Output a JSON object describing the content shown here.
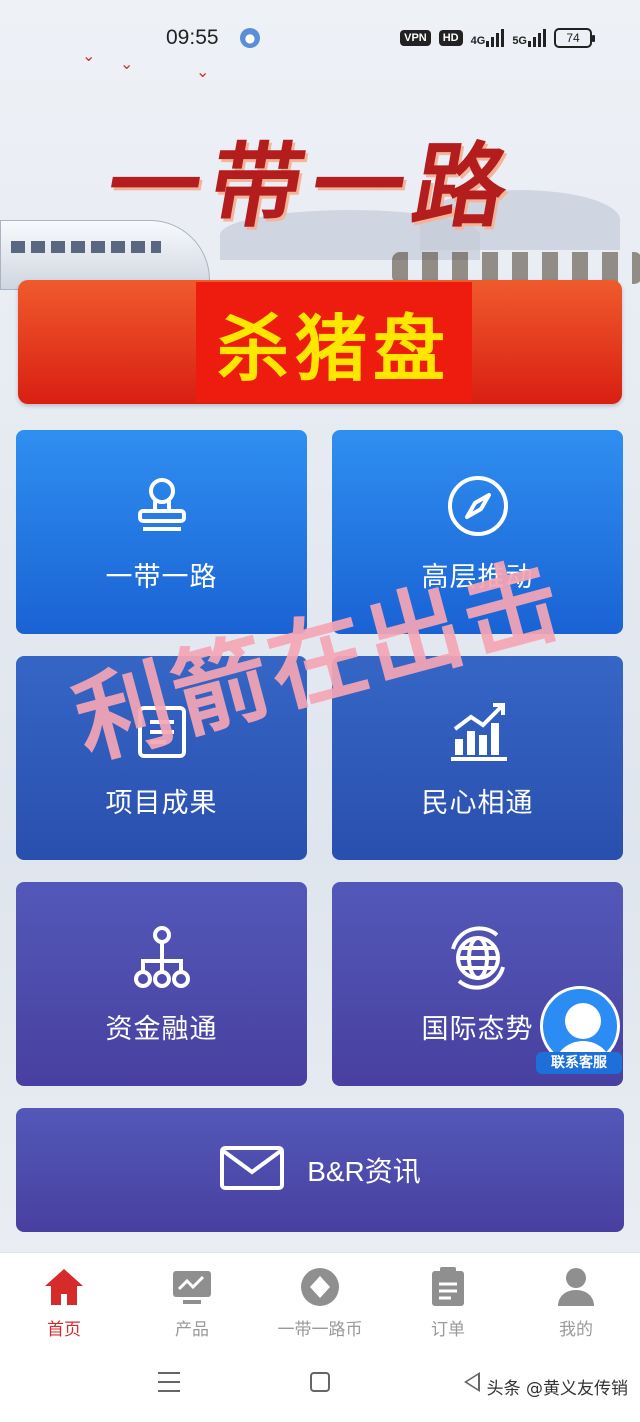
{
  "status_bar": {
    "time": "09:55",
    "vpn": "VPN",
    "hd": "HD",
    "net1": "4G",
    "net2": "5G",
    "battery": "74"
  },
  "hero": {
    "title": "一带一路"
  },
  "banner": {
    "text": "杀猪盘"
  },
  "tiles": [
    {
      "label": "一带一路",
      "icon": "stamp-icon"
    },
    {
      "label": "高层推动",
      "icon": "compass-icon"
    },
    {
      "label": "项目成果",
      "icon": "document-icon"
    },
    {
      "label": "民心相通",
      "icon": "bar-chart-icon"
    },
    {
      "label": "资金融通",
      "icon": "network-icon"
    },
    {
      "label": "国际态势",
      "icon": "globe-icon"
    }
  ],
  "news": {
    "label": "B&R资讯",
    "icon": "envelope-icon"
  },
  "watermark": {
    "text": "利箭在出击"
  },
  "support": {
    "label": "联系客服"
  },
  "nav": {
    "items": [
      {
        "label": "首页",
        "icon": "home-icon",
        "active": true
      },
      {
        "label": "产品",
        "icon": "monitor-icon",
        "active": false
      },
      {
        "label": "一带一路币",
        "icon": "coin-icon",
        "active": false
      },
      {
        "label": "订单",
        "icon": "clipboard-icon",
        "active": false
      },
      {
        "label": "我的",
        "icon": "user-icon",
        "active": false
      }
    ]
  },
  "footer": {
    "credit": "头条 @黄义友传销"
  },
  "colors": {
    "active_nav": "#d62b2b",
    "inactive_nav": "#9a9a9a",
    "banner_text": "#ffe600",
    "banner_bg": "#ee1c0f",
    "watermark": "#f5a6b5"
  }
}
